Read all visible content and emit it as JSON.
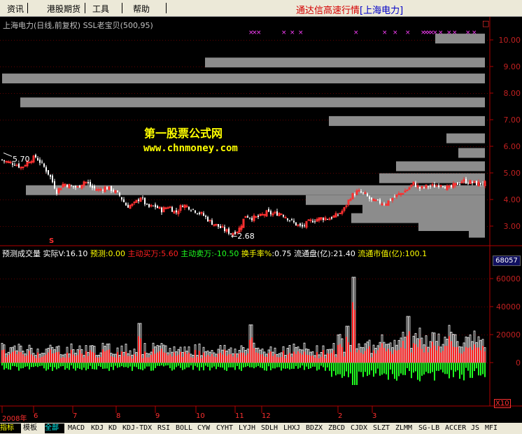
{
  "menu": {
    "items": [
      "资讯",
      "港股期货",
      "工具",
      "帮助"
    ],
    "title_prefix": "通达信高速行情",
    "title_stock": "[上海电力]"
  },
  "top_panel": {
    "title": "上海电力(日线,前复权) SSL老宝贝(500,95)",
    "corner_box": "□",
    "high_label": "5.70",
    "low_label": "←2.68",
    "s_marker": "S"
  },
  "watermark": {
    "line1": "第一股票公式网",
    "line2": "www.chnmoney.com"
  },
  "volume_panel": {
    "parts": [
      {
        "text": "预测成交量",
        "color": "#ffffff"
      },
      {
        "text": "实际V:16.10",
        "color": "#ffffff"
      },
      {
        "text": "预测:0.00",
        "color": "#ffff00"
      },
      {
        "text": "主动买万:5.60",
        "color": "#ff2020"
      },
      {
        "text": "主动卖万:-10.50",
        "color": "#20ff20"
      },
      {
        "text": "换手率%",
        "color": "#ffff00"
      },
      {
        "text": ":0.75",
        "color": "#ffffff"
      },
      {
        "text": "流通盘(亿):21.40",
        "color": "#ffffff"
      },
      {
        "text": "流通市值(亿):100.1",
        "color": "#ffff00"
      }
    ],
    "box_value": "68057",
    "unit": "X10"
  },
  "time_axis": [
    "2008年",
    "6",
    "7",
    "8",
    "9",
    "10",
    "11",
    "12",
    "2",
    "3"
  ],
  "bottom_tabs": [
    "指标",
    "模板",
    "全部",
    "MACD",
    "KDJ",
    "KD",
    "KDJ-TDX",
    "RSI",
    "BOLL",
    "CYW",
    "CYHT",
    "LYJH",
    "SDLH",
    "LHXJ",
    "BDZX",
    "ZBCD",
    "CJDX",
    "SLZT",
    "ZLMM",
    "SG-LB",
    "ACCER",
    "JS",
    "MFI"
  ],
  "chart_data": [
    {
      "type": "candlestick",
      "yticks": [
        3.0,
        4.0,
        5.0,
        6.0,
        7.0,
        8.0,
        9.0,
        10.0
      ],
      "ylim": [
        2.5,
        10.5
      ],
      "close_path": [
        [
          0,
          5.5
        ],
        [
          10,
          5.4
        ],
        [
          20,
          5.35
        ],
        [
          30,
          5.2
        ],
        [
          40,
          5.45
        ],
        [
          50,
          5.6
        ],
        [
          60,
          5.3
        ],
        [
          70,
          4.9
        ],
        [
          80,
          4.3
        ],
        [
          90,
          4.6
        ],
        [
          100,
          4.5
        ],
        [
          110,
          4.45
        ],
        [
          120,
          4.7
        ],
        [
          130,
          4.45
        ],
        [
          140,
          4.35
        ],
        [
          150,
          4.45
        ],
        [
          160,
          4.35
        ],
        [
          170,
          4.15
        ],
        [
          180,
          3.75
        ],
        [
          190,
          3.8
        ],
        [
          200,
          4.1
        ],
        [
          210,
          3.7
        ],
        [
          220,
          3.75
        ],
        [
          230,
          3.6
        ],
        [
          240,
          3.75
        ],
        [
          250,
          3.5
        ],
        [
          260,
          3.8
        ],
        [
          270,
          3.7
        ],
        [
          280,
          3.55
        ],
        [
          290,
          3.4
        ],
        [
          300,
          3.15
        ],
        [
          310,
          3.0
        ],
        [
          320,
          2.85
        ],
        [
          330,
          2.72
        ],
        [
          340,
          2.85
        ],
        [
          350,
          3.4
        ],
        [
          360,
          3.3
        ],
        [
          370,
          3.35
        ],
        [
          380,
          3.5
        ],
        [
          390,
          3.45
        ],
        [
          400,
          3.5
        ],
        [
          410,
          3.3
        ],
        [
          420,
          3.1
        ],
        [
          430,
          2.95
        ],
        [
          440,
          3.15
        ],
        [
          450,
          3.25
        ],
        [
          460,
          3.3
        ],
        [
          470,
          3.3
        ],
        [
          480,
          3.4
        ],
        [
          490,
          3.6
        ],
        [
          500,
          4.1
        ],
        [
          510,
          4.3
        ],
        [
          520,
          4.2
        ],
        [
          530,
          3.95
        ],
        [
          540,
          3.9
        ],
        [
          550,
          3.85
        ],
        [
          560,
          4.05
        ],
        [
          570,
          4.2
        ],
        [
          580,
          4.35
        ],
        [
          590,
          4.6
        ],
        [
          600,
          4.4
        ],
        [
          610,
          4.5
        ],
        [
          620,
          4.5
        ],
        [
          630,
          4.6
        ],
        [
          640,
          4.4
        ],
        [
          650,
          4.55
        ],
        [
          660,
          4.7
        ],
        [
          670,
          4.65
        ],
        [
          680,
          4.6
        ],
        [
          693,
          4.6
        ]
      ],
      "volume_profile_bars": [
        {
          "x_start": 622,
          "price": 10.05
        },
        {
          "x_start": 293,
          "price": 9.15
        },
        {
          "x_start": 3,
          "price": 8.55
        },
        {
          "x_start": 29,
          "price": 7.65
        },
        {
          "x_start": 470,
          "price": 6.95
        },
        {
          "x_start": 638,
          "price": 6.3
        },
        {
          "x_start": 655,
          "price": 5.75
        },
        {
          "x_start": 566,
          "price": 5.25
        },
        {
          "x_start": 542,
          "price": 4.8
        },
        {
          "x_start": 37,
          "price": 4.35
        },
        {
          "x_start": 437,
          "price": 3.98
        },
        {
          "x_start": 518,
          "price": 3.65
        },
        {
          "x_start": 502,
          "price": 3.3
        },
        {
          "x_start": 598,
          "price": 3.0
        },
        {
          "x_start": 670,
          "price": 2.75
        }
      ],
      "signal_x": [
        355,
        360,
        366,
        402,
        414,
        426,
        505,
        546,
        561,
        579,
        601,
        605,
        609,
        613,
        618,
        626,
        638,
        646,
        665,
        674
      ]
    },
    {
      "type": "bar",
      "yticks": [
        0,
        20000,
        40000,
        60000
      ],
      "ylim": [
        -30000,
        70000
      ],
      "series": [
        {
          "name": "主动买万",
          "color": "#ff2020"
        },
        {
          "name": "主动卖万",
          "color": "#20ff20"
        }
      ]
    }
  ]
}
